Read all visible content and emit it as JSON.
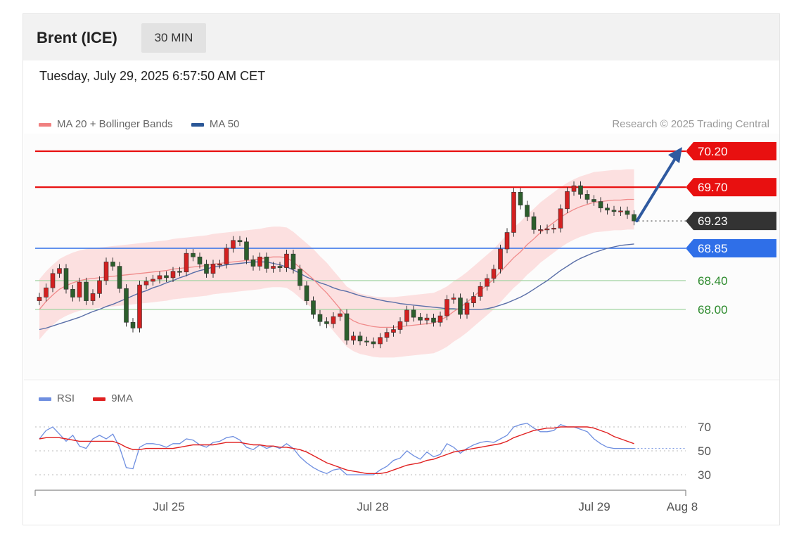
{
  "header": {
    "title": "Brent (ICE)",
    "timeframe": "30 MIN",
    "datetime": "Tuesday, July 29, 2025 6:57:50 AM CET",
    "credit": "Research © 2025 Trading Central"
  },
  "legend_main": [
    {
      "label": "MA 20 + Bollinger Bands",
      "color": "#f08080"
    },
    {
      "label": "MA 50",
      "color": "#2b5797"
    }
  ],
  "legend_rsi": [
    {
      "label": "RSI",
      "color": "#6f8fe0"
    },
    {
      "label": "9MA",
      "color": "#e02020"
    }
  ],
  "chart_data": [
    {
      "type": "candlestick",
      "title": "Brent (ICE)",
      "y_range": [
        67.3,
        70.3
      ],
      "x_ticks": [
        "Jul 25",
        "Jul 28",
        "Jul 29",
        "Aug 8"
      ],
      "levels": [
        {
          "value": 70.2,
          "label": "70.20",
          "style": "resistance",
          "color": "#e81010"
        },
        {
          "value": 69.7,
          "label": "69.70",
          "style": "resistance",
          "color": "#e81010"
        },
        {
          "value": 69.23,
          "label": "69.23",
          "style": "last-price",
          "color": "#333333"
        },
        {
          "value": 68.85,
          "label": "68.85",
          "style": "pivot",
          "color": "#2f6fe8"
        },
        {
          "value": 68.4,
          "label": "68.40",
          "style": "support",
          "color": "#2e8b2e"
        },
        {
          "value": 68.0,
          "label": "68.00",
          "style": "support",
          "color": "#2e8b2e"
        }
      ],
      "close": [
        68.17,
        68.3,
        68.5,
        68.57,
        68.28,
        68.17,
        68.38,
        68.12,
        68.22,
        68.4,
        68.66,
        68.6,
        68.29,
        67.82,
        67.74,
        68.34,
        68.39,
        68.42,
        68.47,
        68.44,
        68.53,
        68.52,
        68.78,
        68.73,
        68.63,
        68.5,
        68.63,
        68.63,
        68.85,
        68.96,
        68.94,
        68.69,
        68.6,
        68.73,
        68.57,
        68.6,
        68.58,
        68.77,
        68.56,
        68.33,
        68.12,
        67.93,
        67.83,
        67.8,
        67.9,
        67.94,
        67.57,
        67.63,
        67.56,
        67.55,
        67.52,
        67.61,
        67.68,
        67.72,
        67.83,
        67.99,
        67.89,
        67.85,
        67.88,
        67.82,
        67.91,
        68.14,
        68.16,
        67.93,
        68.09,
        68.18,
        68.32,
        68.43,
        68.56,
        68.84,
        69.07,
        69.63,
        69.45,
        69.29,
        69.11,
        69.11,
        69.12,
        69.13,
        69.4,
        69.64,
        69.72,
        69.6,
        69.53,
        69.5,
        69.41,
        69.38,
        69.36,
        69.37,
        69.32,
        69.23
      ],
      "ma20": [
        68.0,
        68.11,
        68.2,
        68.28,
        68.33,
        68.37,
        68.4,
        68.42,
        68.43,
        68.44,
        68.45,
        68.46,
        68.47,
        68.48,
        68.49,
        68.5,
        68.51,
        68.52,
        68.53,
        68.54,
        68.56,
        68.57,
        68.58,
        68.59,
        68.6,
        68.61,
        68.63,
        68.64,
        68.65,
        68.66,
        68.67,
        68.68,
        68.69,
        68.7,
        68.72,
        68.73,
        68.73,
        68.72,
        68.66,
        68.58,
        68.5,
        68.42,
        68.32,
        68.23,
        68.12,
        68.01,
        67.9,
        67.84,
        67.8,
        67.78,
        67.76,
        67.75,
        67.75,
        67.75,
        67.76,
        67.77,
        67.78,
        67.79,
        67.8,
        67.81,
        67.85,
        67.9,
        67.97,
        68.03,
        68.1,
        68.18,
        68.26,
        68.34,
        68.42,
        68.52,
        68.62,
        68.72,
        68.8,
        68.9,
        68.98,
        69.07,
        69.14,
        69.21,
        69.28,
        69.34,
        69.39,
        69.43,
        69.46,
        69.49,
        69.5,
        69.51,
        69.52,
        69.52,
        69.53,
        69.53
      ],
      "ma50": [
        67.72,
        67.74,
        67.77,
        67.8,
        67.83,
        67.86,
        67.89,
        67.93,
        67.97,
        68.0,
        68.04,
        68.07,
        68.11,
        68.15,
        68.19,
        68.23,
        68.26,
        68.3,
        68.33,
        68.37,
        68.4,
        68.44,
        68.47,
        68.51,
        68.54,
        68.56,
        68.59,
        68.6,
        68.62,
        68.63,
        68.64,
        68.65,
        68.66,
        68.66,
        68.66,
        68.64,
        68.62,
        68.59,
        68.55,
        68.5,
        68.45,
        68.41,
        68.37,
        68.34,
        68.3,
        68.27,
        68.25,
        68.22,
        68.19,
        68.17,
        68.15,
        68.13,
        68.11,
        68.1,
        68.08,
        68.07,
        68.06,
        68.05,
        68.04,
        68.03,
        68.02,
        68.01,
        68.01,
        68.0,
        68.0,
        68.0,
        68.0,
        68.01,
        68.03,
        68.06,
        68.09,
        68.13,
        68.17,
        68.22,
        68.28,
        68.34,
        68.4,
        68.47,
        68.54,
        68.6,
        68.66,
        68.71,
        68.75,
        68.79,
        68.82,
        68.85,
        68.87,
        68.89,
        68.9,
        68.91
      ],
      "rsi_levels": [
        70,
        50,
        30
      ],
      "rsi": [
        60,
        67,
        70,
        64,
        58,
        63,
        54,
        52,
        60,
        63,
        60,
        64,
        53,
        36,
        35,
        53,
        56,
        56,
        55,
        53,
        56,
        56,
        60,
        59,
        55,
        53,
        57,
        58,
        61,
        62,
        59,
        53,
        51,
        55,
        52,
        54,
        52,
        56,
        52,
        45,
        40,
        36,
        33,
        31,
        34,
        35,
        30,
        30,
        30,
        30,
        30,
        34,
        37,
        42,
        44,
        50,
        46,
        43,
        49,
        45,
        47,
        56,
        53,
        48,
        52,
        55,
        57,
        58,
        57,
        60,
        63,
        70,
        72,
        73,
        69,
        66,
        66,
        67,
        72,
        70,
        70,
        68,
        66,
        60,
        56,
        53,
        52,
        52,
        52,
        52
      ],
      "rsi_ma9": [
        60,
        61,
        61,
        61,
        60,
        59,
        58,
        58,
        58,
        58,
        58,
        58,
        56,
        53,
        51,
        51,
        52,
        52,
        52,
        52,
        52,
        53,
        54,
        55,
        55,
        55,
        55,
        56,
        57,
        57,
        57,
        56,
        55,
        55,
        54,
        54,
        53,
        53,
        52,
        51,
        49,
        46,
        43,
        40,
        38,
        36,
        34,
        33,
        32,
        31,
        31,
        31,
        32,
        34,
        36,
        38,
        39,
        40,
        42,
        43,
        45,
        47,
        49,
        50,
        51,
        52,
        53,
        54,
        55,
        56,
        58,
        61,
        63,
        65,
        67,
        68,
        69,
        69,
        70,
        70,
        70,
        70,
        70,
        69,
        67,
        65,
        62,
        60,
        58,
        56
      ]
    }
  ]
}
